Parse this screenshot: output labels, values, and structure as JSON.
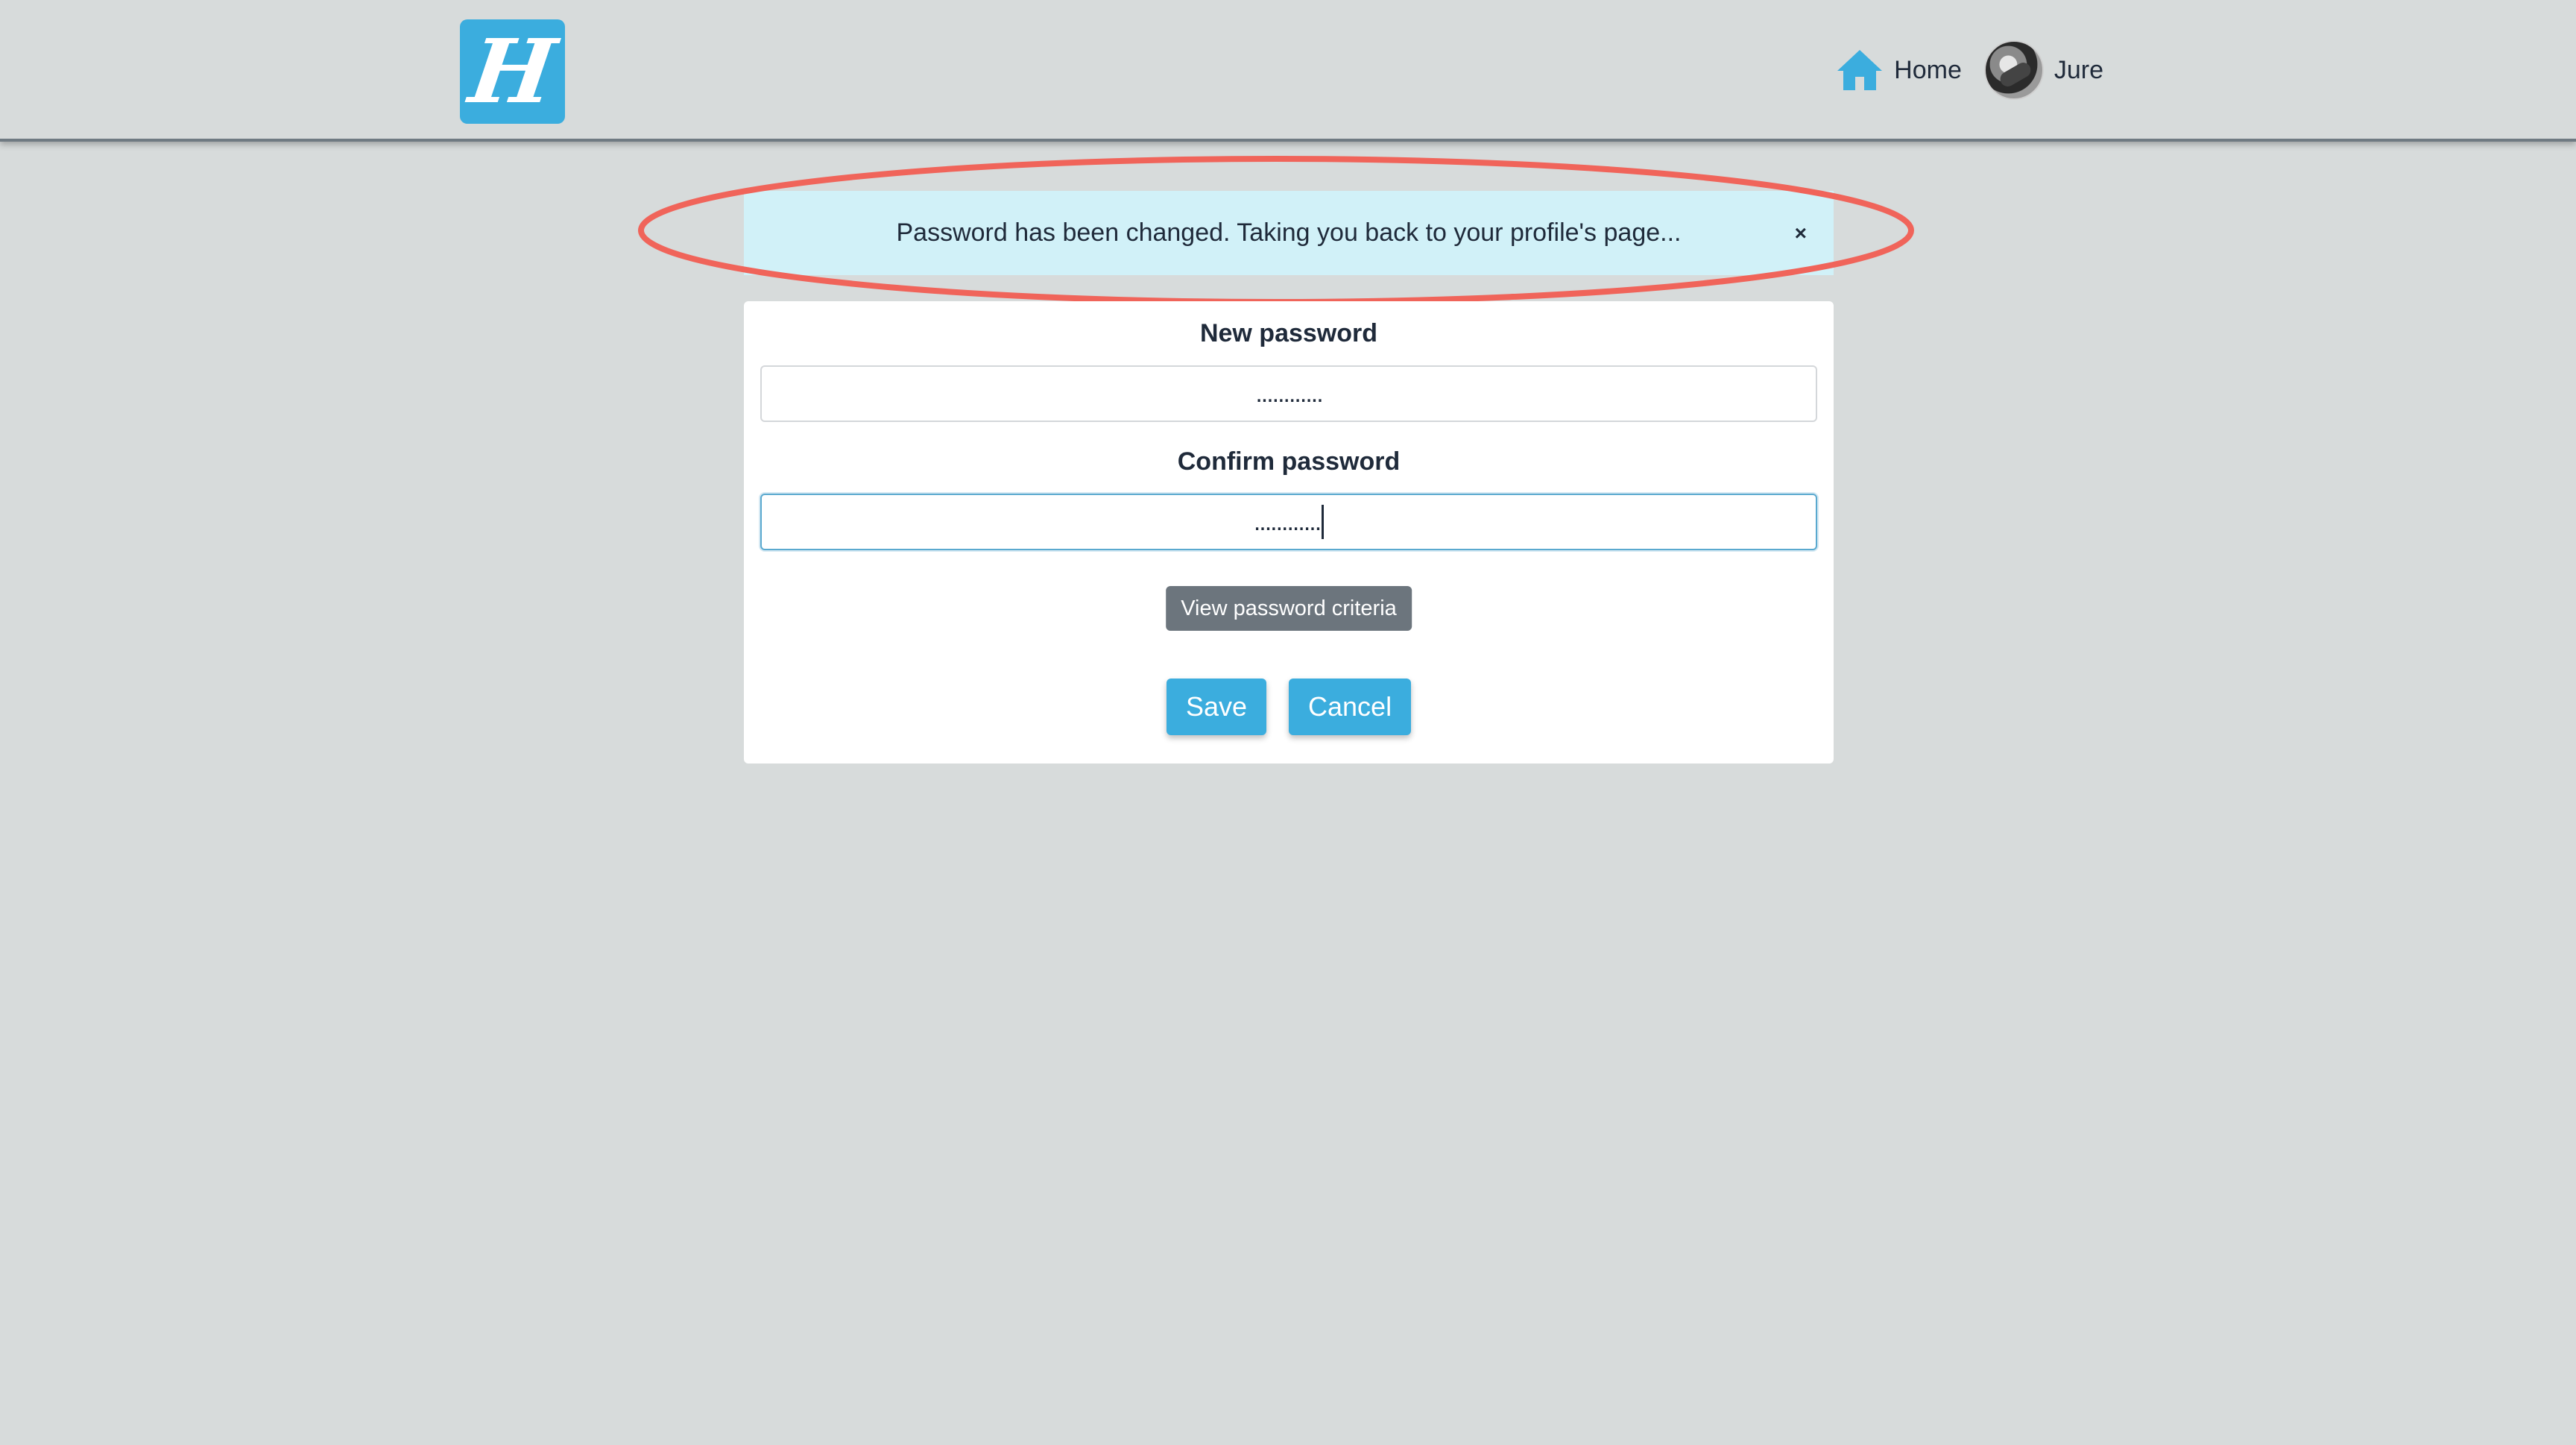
{
  "header": {
    "logo_letter": "H",
    "nav": {
      "home_label": "Home",
      "user_label": "Jure"
    }
  },
  "alert": {
    "message": "Password has been changed. Taking you back to your profile's page...",
    "close_symbol": "×"
  },
  "form": {
    "new_password_label": "New password",
    "new_password_value": "............",
    "confirm_password_label": "Confirm password",
    "confirm_password_value": "............",
    "criteria_button": "View password criteria",
    "save_button": "Save",
    "cancel_button": "Cancel"
  },
  "colors": {
    "brand": "#3badde",
    "page_background": "#d7dbdb",
    "alert_background": "#d1f1f8",
    "highlight": "#f0645a",
    "secondary_button": "#6c757d"
  },
  "icons": {
    "home": "home-icon",
    "close": "close-icon"
  }
}
